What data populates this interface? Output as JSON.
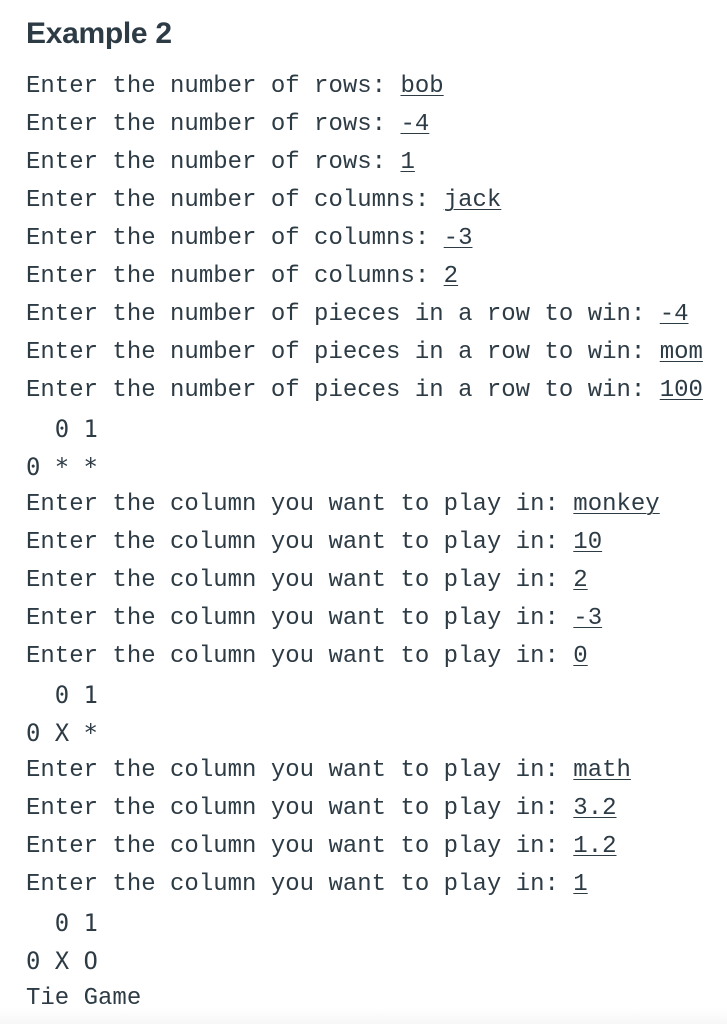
{
  "title": "Example 2",
  "lines": [
    {
      "type": "prompt",
      "prompt": "Enter the number of rows: ",
      "input": "bob"
    },
    {
      "type": "prompt",
      "prompt": "Enter the number of rows: ",
      "input": "-4"
    },
    {
      "type": "prompt",
      "prompt": "Enter the number of rows: ",
      "input": "1"
    },
    {
      "type": "prompt",
      "prompt": "Enter the number of columns: ",
      "input": "jack"
    },
    {
      "type": "prompt",
      "prompt": "Enter the number of columns: ",
      "input": "-3"
    },
    {
      "type": "prompt",
      "prompt": "Enter the number of columns: ",
      "input": "2"
    },
    {
      "type": "prompt",
      "prompt": "Enter the number of pieces in a row to win: ",
      "input": "-4"
    },
    {
      "type": "prompt",
      "prompt": "Enter the number of pieces in a row to win: ",
      "input": "mom"
    },
    {
      "type": "prompt",
      "prompt": "Enter the number of pieces in a row to win: ",
      "input": "100"
    },
    {
      "type": "board",
      "text": "  0 1"
    },
    {
      "type": "board",
      "text": "0 * *"
    },
    {
      "type": "prompt",
      "prompt": "Enter the column you want to play in: ",
      "input": "monkey"
    },
    {
      "type": "prompt",
      "prompt": "Enter the column you want to play in: ",
      "input": "10"
    },
    {
      "type": "prompt",
      "prompt": "Enter the column you want to play in: ",
      "input": "2"
    },
    {
      "type": "prompt",
      "prompt": "Enter the column you want to play in: ",
      "input": "-3"
    },
    {
      "type": "prompt",
      "prompt": "Enter the column you want to play in: ",
      "input": "0"
    },
    {
      "type": "board",
      "text": "  0 1"
    },
    {
      "type": "board",
      "text": "0 X *"
    },
    {
      "type": "prompt",
      "prompt": "Enter the column you want to play in: ",
      "input": "math"
    },
    {
      "type": "prompt",
      "prompt": "Enter the column you want to play in: ",
      "input": "3.2"
    },
    {
      "type": "prompt",
      "prompt": "Enter the column you want to play in: ",
      "input": "1.2"
    },
    {
      "type": "prompt",
      "prompt": "Enter the column you want to play in: ",
      "input": "1"
    },
    {
      "type": "board",
      "text": "  0 1"
    },
    {
      "type": "board",
      "text": "0 X O"
    },
    {
      "type": "output",
      "text": "Tie Game"
    }
  ]
}
